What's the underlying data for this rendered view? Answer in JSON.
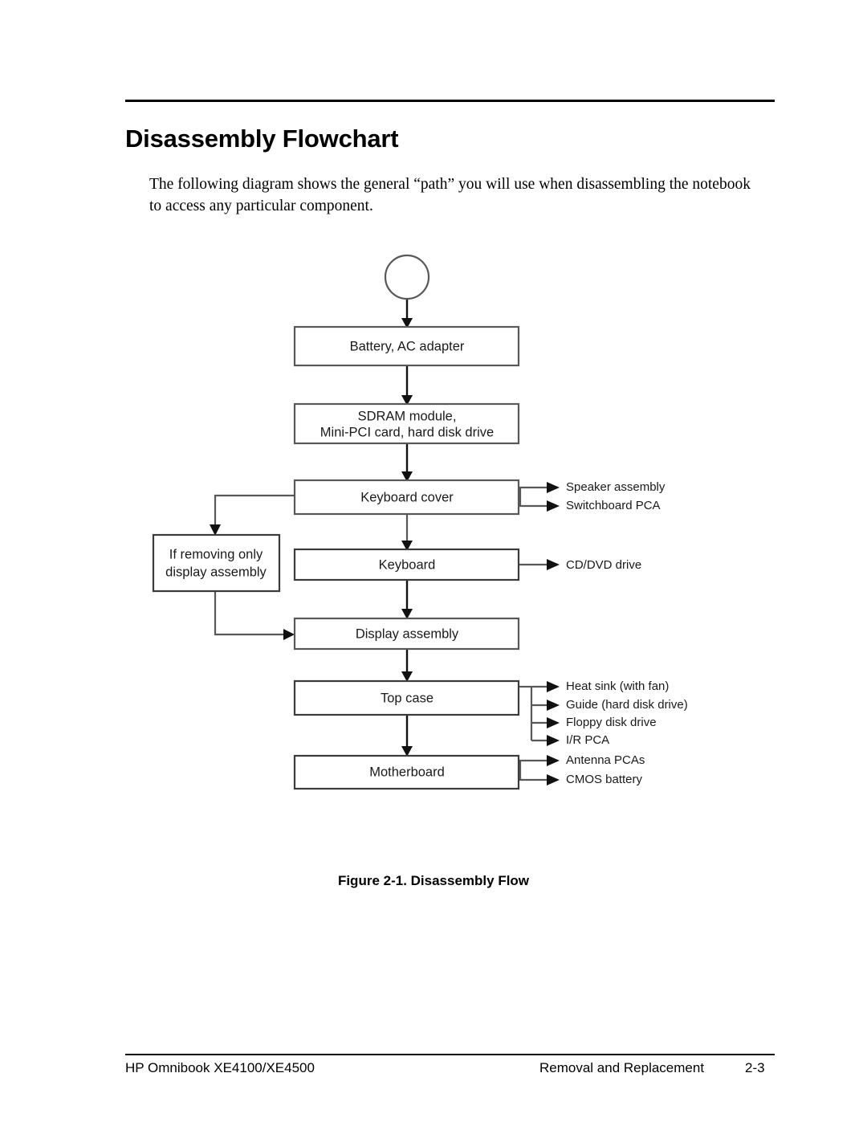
{
  "document": {
    "title": "Disassembly Flowchart",
    "intro": "The following diagram shows the general “path” you will use when disassembling the notebook to access any particular component.",
    "figure_caption": "Figure 2-1. Disassembly Flow"
  },
  "footer": {
    "left": "HP Omnibook XE4100/XE4500",
    "center": "Removal and Replacement",
    "page_number": "2-3"
  },
  "chart_data": {
    "type": "diagram",
    "title": "Figure 2-1. Disassembly Flow",
    "orientation": "top-to-bottom",
    "nodes": [
      {
        "id": "start",
        "shape": "circle",
        "label": ""
      },
      {
        "id": "battery",
        "shape": "rect",
        "label": "Battery, AC adapter"
      },
      {
        "id": "sdram",
        "shape": "rect",
        "label_line1": "SDRAM module,",
        "label_line2": "Mini-PCI card, hard disk drive"
      },
      {
        "id": "keyboard_cover",
        "shape": "rect",
        "label": "Keyboard cover"
      },
      {
        "id": "if_display",
        "shape": "rect",
        "label_line1": "If removing only",
        "label_line2": "display assembly"
      },
      {
        "id": "keyboard",
        "shape": "rect",
        "label": "Keyboard"
      },
      {
        "id": "display_assembly",
        "shape": "rect",
        "label": "Display assembly"
      },
      {
        "id": "top_case",
        "shape": "rect",
        "label": "Top case"
      },
      {
        "id": "motherboard",
        "shape": "rect",
        "label": "Motherboard"
      }
    ],
    "branches": [
      {
        "from": "keyboard_cover",
        "label": "Speaker assembly"
      },
      {
        "from": "keyboard_cover",
        "label": "Switchboard PCA"
      },
      {
        "from": "keyboard",
        "label": "CD/DVD drive"
      },
      {
        "from": "top_case",
        "label": "Heat sink (with fan)"
      },
      {
        "from": "top_case",
        "label": "Guide (hard disk drive)"
      },
      {
        "from": "top_case",
        "label": "Floppy disk drive"
      },
      {
        "from": "top_case",
        "label": "I/R PCA"
      },
      {
        "from": "motherboard",
        "label": "Antenna PCAs"
      },
      {
        "from": "motherboard",
        "label": "CMOS battery"
      }
    ],
    "edges": [
      {
        "from": "start",
        "to": "battery"
      },
      {
        "from": "battery",
        "to": "sdram"
      },
      {
        "from": "sdram",
        "to": "keyboard_cover"
      },
      {
        "from": "keyboard_cover",
        "to": "keyboard"
      },
      {
        "from": "keyboard_cover",
        "to": "if_display"
      },
      {
        "from": "keyboard",
        "to": "display_assembly"
      },
      {
        "from": "if_display",
        "to": "display_assembly"
      },
      {
        "from": "display_assembly",
        "to": "top_case"
      },
      {
        "from": "top_case",
        "to": "motherboard"
      }
    ]
  },
  "flow": {
    "start": "",
    "battery": "Battery, AC adapter",
    "sdram_line1": "SDRAM module,",
    "sdram_line2": "Mini-PCI card, hard disk drive",
    "keyboard_cover": "Keyboard cover",
    "if_display_line1": "If removing only",
    "if_display_line2": "display assembly",
    "keyboard": "Keyboard",
    "display_assembly": "Display assembly",
    "top_case": "Top case",
    "motherboard": "Motherboard",
    "branch_speaker": "Speaker assembly",
    "branch_switchboard": "Switchboard PCA",
    "branch_cddvd": "CD/DVD drive",
    "branch_heatsink": "Heat sink (with fan)",
    "branch_guide": "Guide (hard disk drive)",
    "branch_floppy": "Floppy disk drive",
    "branch_irpca": "I/R PCA",
    "branch_antenna": "Antenna PCAs",
    "branch_cmos": "CMOS battery"
  }
}
